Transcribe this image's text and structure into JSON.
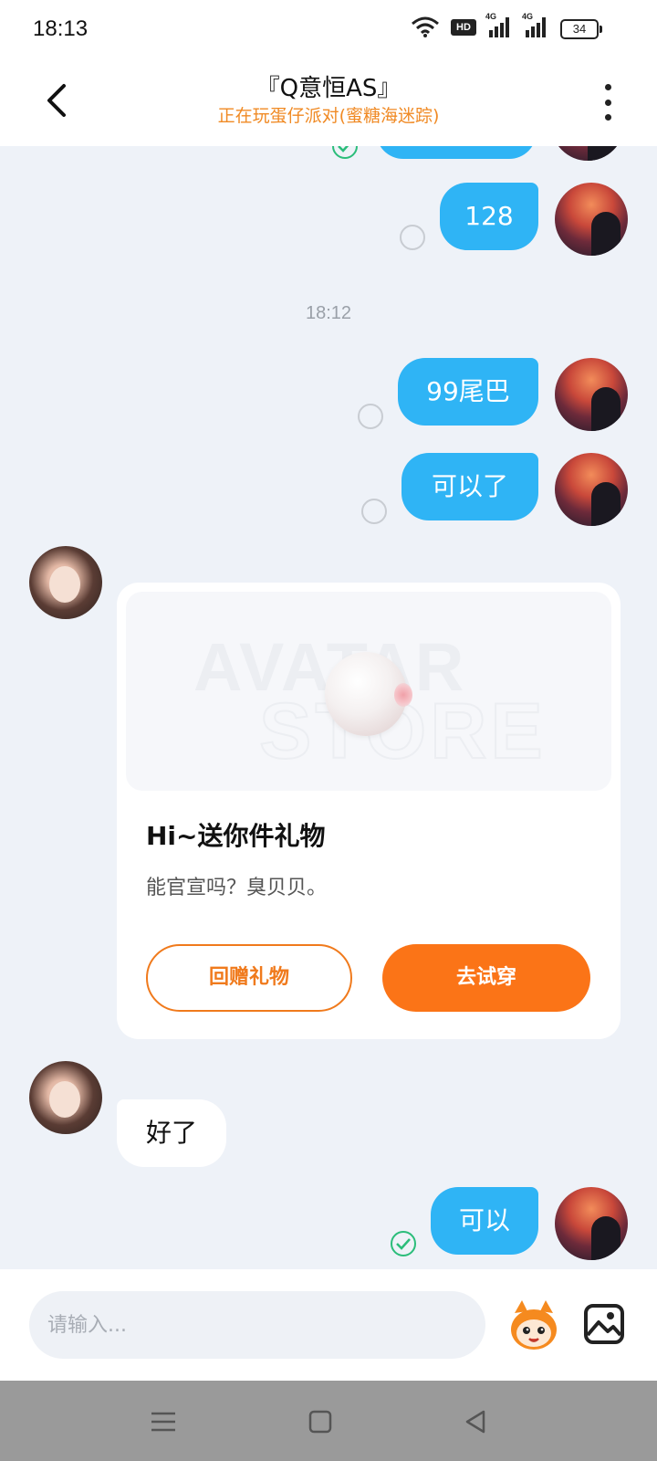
{
  "status_bar": {
    "time": "18:13",
    "hd_label": "HD",
    "signal_1_label": "4G",
    "signal_2_label": "4G",
    "battery": "34"
  },
  "header": {
    "title": "『Q意恒AS』",
    "subtitle": "正在玩蛋仔派对(蜜糖海迷踪)"
  },
  "chat": {
    "timestamp": "18:12",
    "messages": [
      {
        "sender": "self",
        "text": "128",
        "status": "unread"
      },
      {
        "sender": "self",
        "text": "99尾巴",
        "status": "unread"
      },
      {
        "sender": "self",
        "text": "可以了",
        "status": "unread"
      },
      {
        "sender": "other",
        "type": "gift_card"
      },
      {
        "sender": "other",
        "text": "好了"
      },
      {
        "sender": "self",
        "text": "可以",
        "status": "read"
      }
    ]
  },
  "gift_card": {
    "title": "Hi~送你件礼物",
    "message": "能官宣吗？臭贝贝。",
    "return_button": "回赠礼物",
    "try_button": "去试穿"
  },
  "input": {
    "placeholder": "请输入..."
  },
  "colors": {
    "bubble_out": "#2fb4f5",
    "accent_orange": "#fb7417",
    "subtitle_orange": "#f08a24",
    "read_green": "#2bbd7a"
  },
  "icons": [
    "back-arrow-icon",
    "more-vertical-icon",
    "wifi-icon",
    "signal-icon",
    "battery-icon",
    "read-check-icon",
    "mascot-icon",
    "image-icon",
    "menu-icon",
    "home-icon",
    "back-triangle-icon"
  ]
}
